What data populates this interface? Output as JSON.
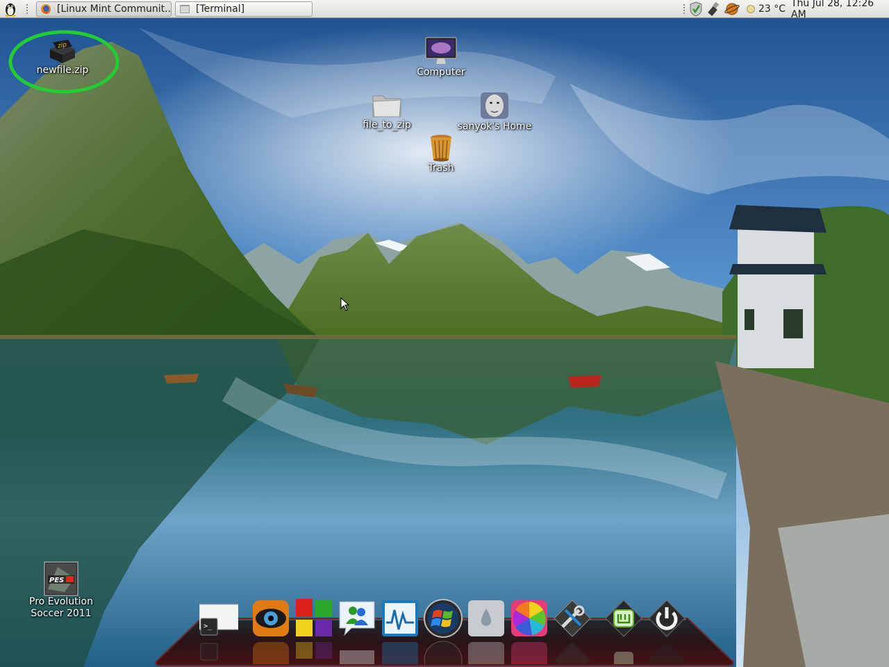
{
  "top_panel": {
    "tasks": [
      {
        "label": "[Linux Mint Communit...",
        "icon": "firefox-icon"
      },
      {
        "label": "[Terminal]",
        "icon": "terminal-icon"
      }
    ],
    "weather": "23 °C",
    "clock": "Thu Jul 28, 12:26 AM"
  },
  "desktop": {
    "icons": [
      {
        "label": "newfile.zip",
        "icon": "zip-archive-icon",
        "highlighted": true
      },
      {
        "label": "Computer",
        "icon": "computer-icon"
      },
      {
        "label": "file_to_zip",
        "icon": "folder-icon"
      },
      {
        "label": "sanyok's Home",
        "icon": "home-icon"
      },
      {
        "label": "Trash",
        "icon": "trash-icon"
      },
      {
        "label": "Pro Evolution Soccer 2011",
        "label_line1": "Pro Evolution",
        "label_line2": "Soccer 2011",
        "icon": "pes-game-icon",
        "logo_text": "PES"
      }
    ]
  },
  "dock": {
    "items": [
      "terminal-icon",
      "eye-browser-icon",
      "colored-squares-icon",
      "messenger-icon",
      "system-monitor-icon",
      "windows-orb-icon",
      "water-drop-icon",
      "color-wheel-icon",
      "settings-tools-icon",
      "linux-mint-menu-icon",
      "power-icon"
    ]
  },
  "colors": {
    "highlight_circle": "#22cc33",
    "panel_bg": "#e6e6e2",
    "desktop_text": "#ffffff"
  }
}
